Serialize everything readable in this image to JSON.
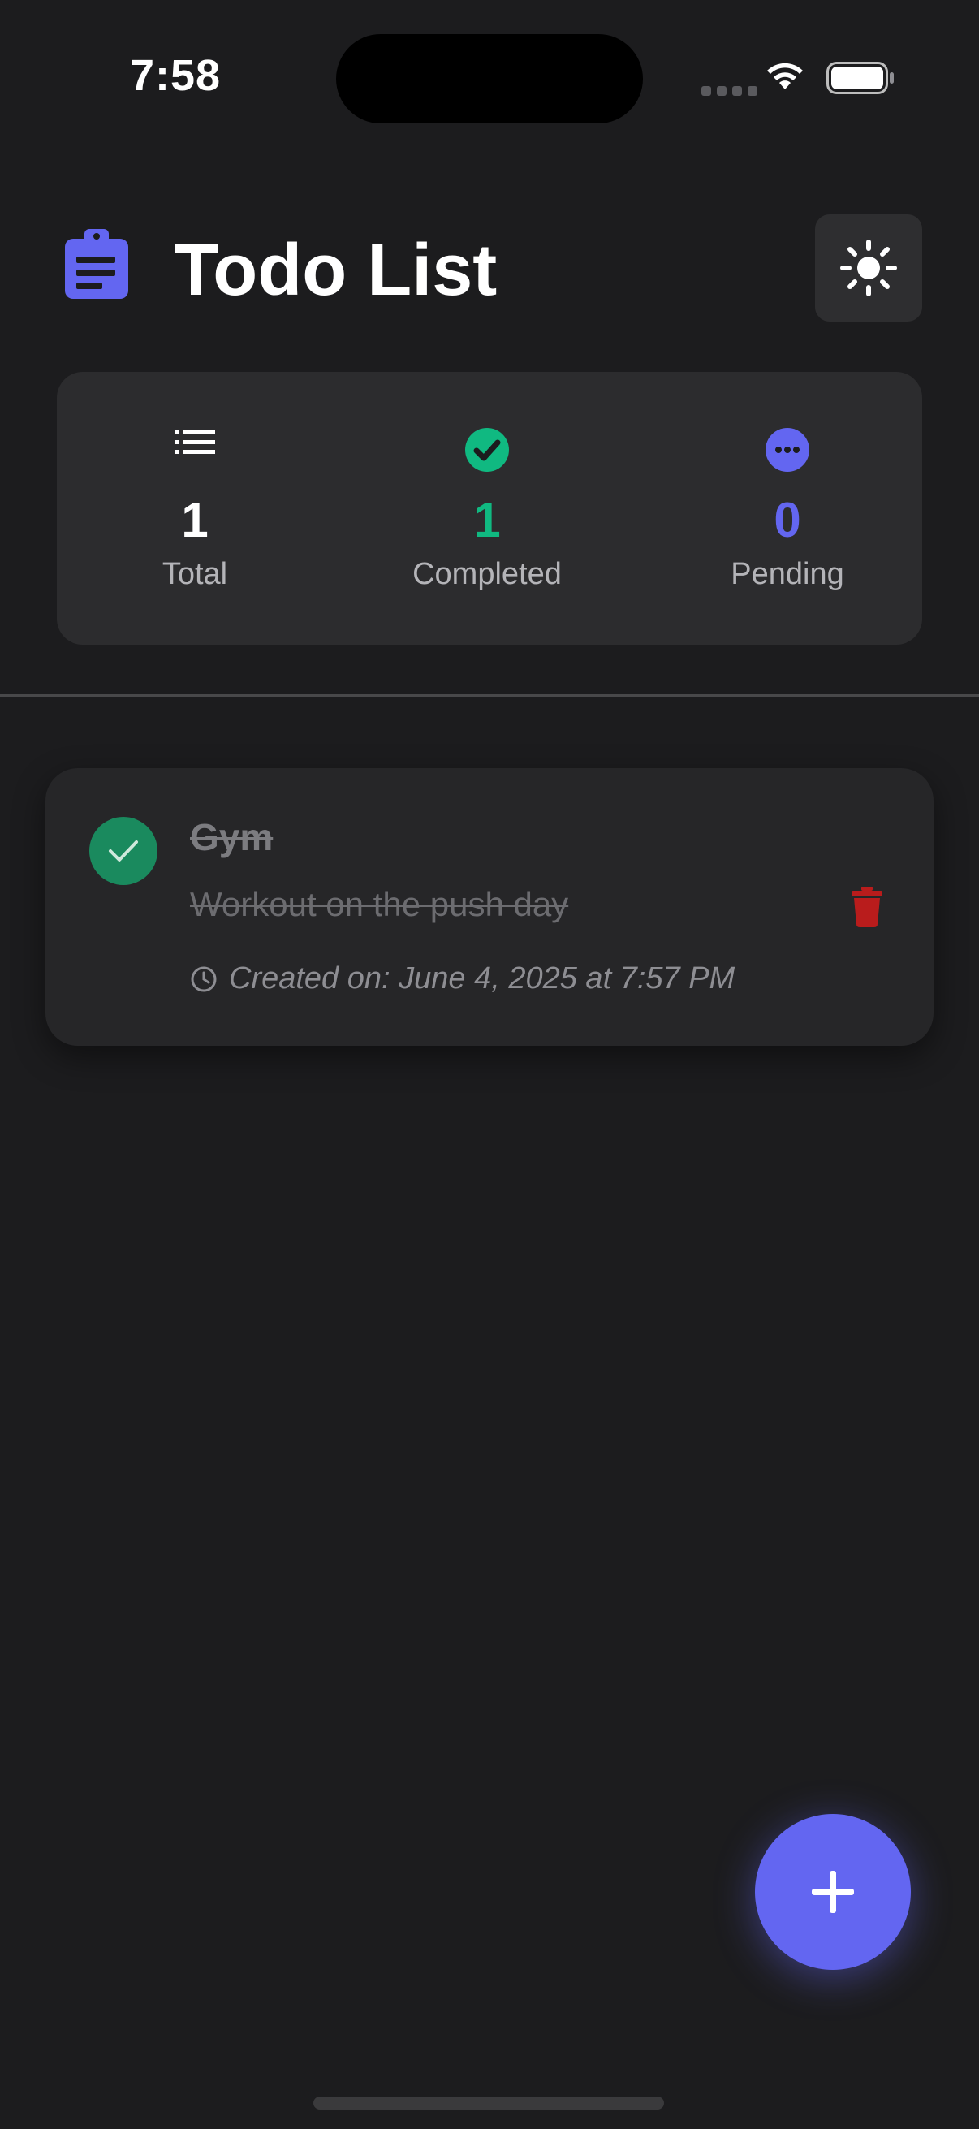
{
  "status_bar": {
    "time": "7:58",
    "icons": [
      "signal-icon",
      "wifi-icon",
      "battery-icon"
    ]
  },
  "header": {
    "title": "Todo List",
    "app_icon": "clipboard-icon",
    "theme_toggle_icon": "sun-icon"
  },
  "stats": {
    "total": {
      "value": "1",
      "label": "Total",
      "icon": "list-icon"
    },
    "completed": {
      "value": "1",
      "label": "Completed",
      "icon": "check-circle-icon",
      "color": "#10b981"
    },
    "pending": {
      "value": "0",
      "label": "Pending",
      "icon": "ellipsis-circle-icon",
      "color": "#6366f1"
    }
  },
  "todos": [
    {
      "title": "Gym",
      "description": "Workout on the push day",
      "created": "Created on: June 4, 2025 at 7:57 PM",
      "completed": true
    }
  ],
  "colors": {
    "accent": "#6366f1",
    "success": "#10b981",
    "danger": "#b91c1c",
    "background": "#1c1c1e",
    "card": "#2c2c2e"
  },
  "fab": {
    "icon": "plus-icon"
  }
}
